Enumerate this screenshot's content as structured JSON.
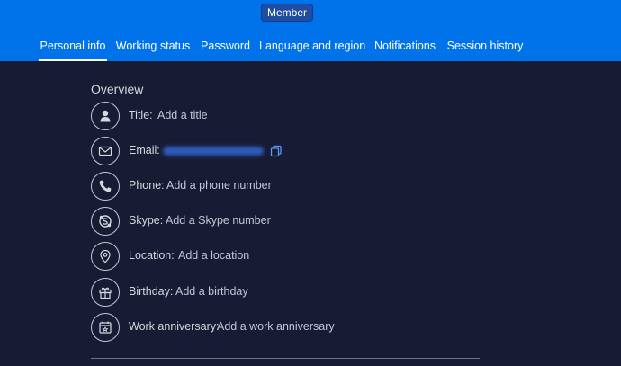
{
  "header": {
    "badge": "Member",
    "tabs": [
      {
        "label": "Personal info",
        "active": true
      },
      {
        "label": "Working status",
        "active": false
      },
      {
        "label": "Password",
        "active": false
      },
      {
        "label": "Language and region",
        "active": false
      },
      {
        "label": "Notifications",
        "active": false
      },
      {
        "label": "Session history",
        "active": false
      }
    ]
  },
  "overview": {
    "title": "Overview",
    "rows": [
      {
        "icon": "person-icon",
        "label": "Title:",
        "value": "Add a title"
      },
      {
        "icon": "envelope-icon",
        "label": "Email:",
        "value": ""
      },
      {
        "icon": "phone-icon",
        "label": "Phone:",
        "value": "Add a phone number"
      },
      {
        "icon": "skype-icon",
        "label": "Skype:",
        "value": "Add a Skype number"
      },
      {
        "icon": "location-pin-icon",
        "label": "Location:",
        "value": "Add a location"
      },
      {
        "icon": "gift-icon",
        "label": "Birthday:",
        "value": "Add a birthday"
      },
      {
        "icon": "calendar-icon",
        "label": "Work anniversary:",
        "value": "Add a work anniversary"
      }
    ]
  },
  "colors": {
    "header_bg": "#0073ea",
    "page_bg": "#181b34",
    "badge_bg": "#1f4da3",
    "link": "#579bfc"
  }
}
